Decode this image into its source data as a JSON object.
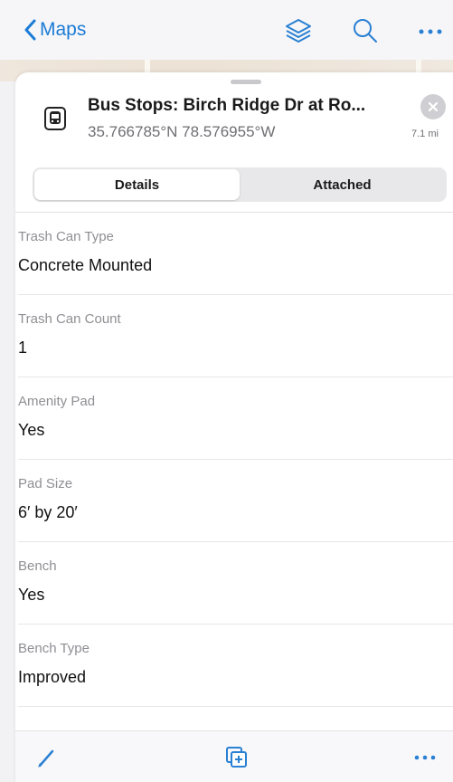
{
  "nav": {
    "back_label": "Maps",
    "icons": [
      "chevron-left-icon",
      "layers-icon",
      "search-icon",
      "more-icon"
    ]
  },
  "feature": {
    "icon": "bus-icon",
    "title": "Bus Stops: Birch Ridge Dr at Ro...",
    "coordinates": "35.766785°N  78.576955°W",
    "distance": "7.1 mi"
  },
  "tabs": [
    {
      "label": "Details",
      "selected": true
    },
    {
      "label": "Attached",
      "selected": false
    }
  ],
  "fields": [
    {
      "label": "Trash Can Type",
      "value": "Concrete Mounted"
    },
    {
      "label": "Trash Can Count",
      "value": "1"
    },
    {
      "label": "Amenity Pad",
      "value": "Yes"
    },
    {
      "label": "Pad Size",
      "value": "6′ by 20′"
    },
    {
      "label": "Bench",
      "value": "Yes"
    },
    {
      "label": "Bench Type",
      "value": "Improved"
    }
  ],
  "toolbar": {
    "icons": [
      "edit-icon",
      "add-related-icon",
      "more-icon"
    ]
  },
  "colors": {
    "accent": "#1b7bd6",
    "label_gray": "#8f8f94"
  }
}
